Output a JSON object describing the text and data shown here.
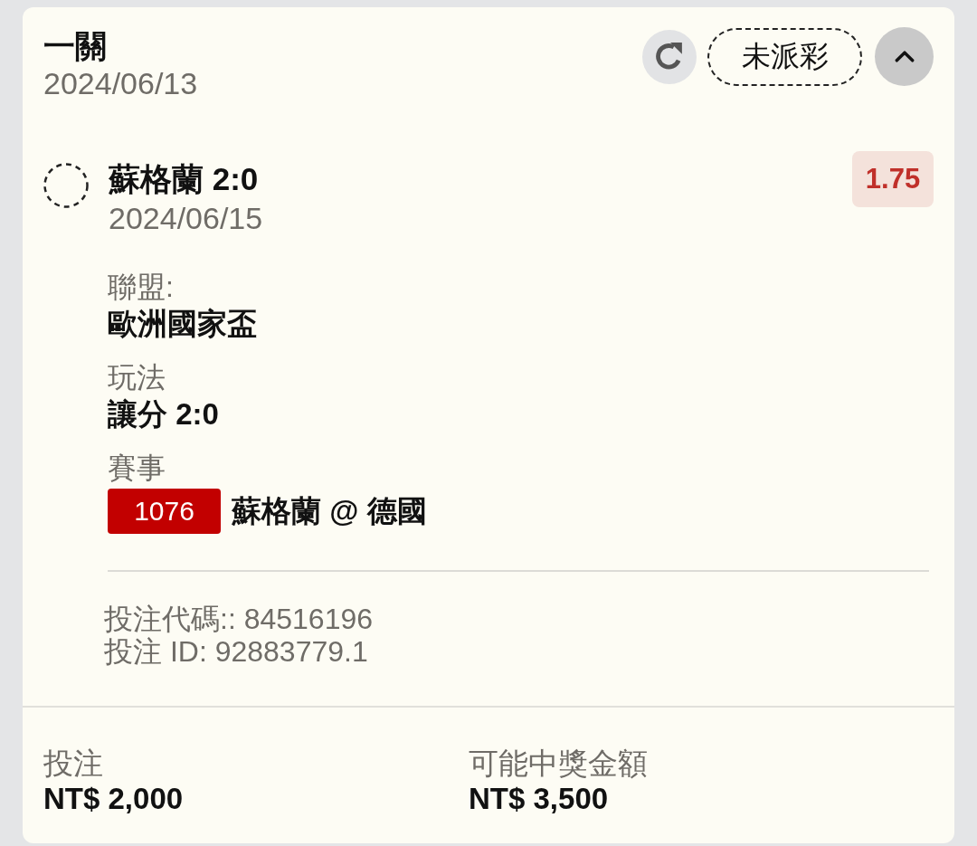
{
  "header": {
    "title": "一關",
    "date": "2024/06/13",
    "status": "未派彩",
    "expanded": true
  },
  "selection": {
    "name": "蘇格蘭 2:0",
    "date": "2024/06/15",
    "odds": "1.75"
  },
  "details": [
    {
      "label": "聯盟:",
      "value": "歐洲國家盃"
    },
    {
      "label": "玩法",
      "value": "讓分 2:0"
    },
    {
      "label": "賽事",
      "event_number": "1076",
      "value": "蘇格蘭 @ 德國"
    }
  ],
  "codes": [
    "投注代碼:: 84516196",
    "投注 ID: 92883779.1"
  ],
  "footer": [
    {
      "label": "投注",
      "value": "NT$ 2,000"
    },
    {
      "label": "可能中獎金額",
      "value": "NT$ 3,500"
    }
  ]
}
